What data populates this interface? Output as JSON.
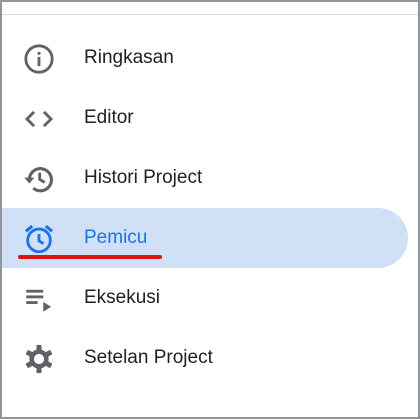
{
  "nav": {
    "items": [
      {
        "label": "Ringkasan",
        "icon": "info-icon",
        "active": false
      },
      {
        "label": "Editor",
        "icon": "code-icon",
        "active": false
      },
      {
        "label": "Histori Project",
        "icon": "history-icon",
        "active": false
      },
      {
        "label": "Pemicu",
        "icon": "alarm-clock-icon",
        "active": true
      },
      {
        "label": "Eksekusi",
        "icon": "playlist-play-icon",
        "active": false
      },
      {
        "label": "Setelan Project",
        "icon": "gear-icon",
        "active": false
      }
    ]
  },
  "colors": {
    "active_background": "#cfe0f7",
    "active_text": "#1a73e8",
    "text": "#202124",
    "icon": "#5f6368",
    "annotation_underline": "#e0101a"
  }
}
